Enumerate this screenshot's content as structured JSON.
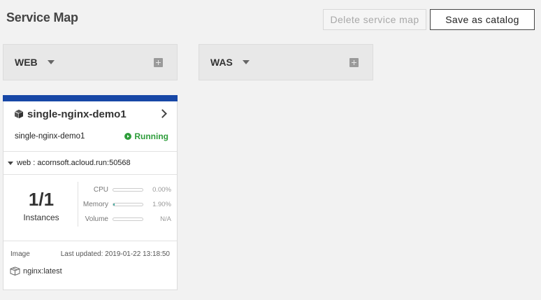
{
  "page": {
    "title": "Service Map"
  },
  "toolbar": {
    "delete_label": "Delete service map",
    "save_label": "Save as catalog"
  },
  "groups": [
    {
      "label": "WEB"
    },
    {
      "label": "WAS"
    }
  ],
  "card": {
    "accent_color": "#1747a6",
    "title": "single-nginx-demo1",
    "subtitle": "single-nginx-demo1",
    "status": "Running",
    "status_color": "#2e9d3b",
    "endpoint": "web : acornsoft.acloud.run:50568",
    "instances": {
      "count": "1/1",
      "label": "Instances"
    },
    "metrics": [
      {
        "label": "CPU",
        "value": "0.00%",
        "fraction": 0.0
      },
      {
        "label": "Memory",
        "value": "1.90%",
        "fraction": 0.019
      },
      {
        "label": "Volume",
        "value": "N/A",
        "fraction": 0
      }
    ],
    "image_label": "Image",
    "last_updated": "Last updated: 2019-01-22 13:18:50",
    "image_name": "nginx:latest"
  },
  "icons": {
    "card_icon": "cube-icon",
    "image_icon": "package-icon",
    "add_icon": "plus-square-icon",
    "status_icon": "play-circle-icon"
  }
}
